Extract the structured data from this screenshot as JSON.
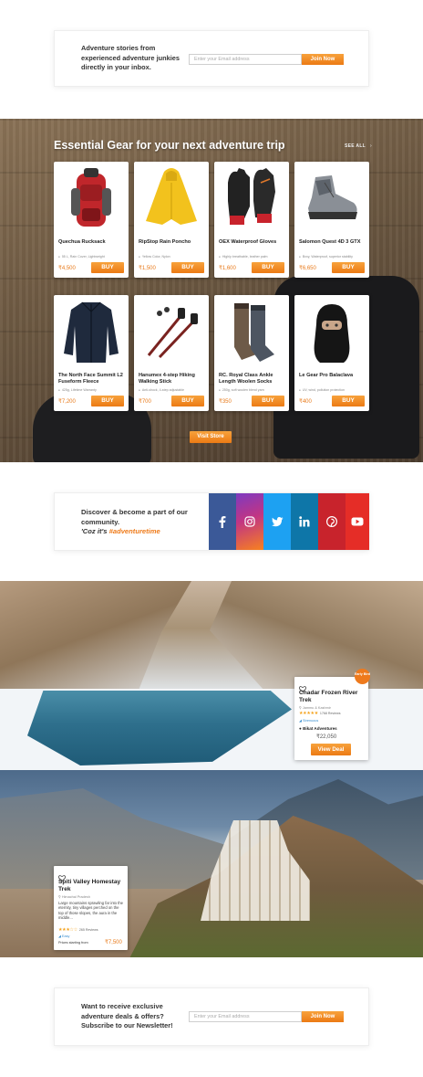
{
  "newsletter_top": {
    "text": "Adventure stories from experienced adventure junkies directly in your inbox.",
    "placeholder": "Enter your Email address",
    "button": "Join Now"
  },
  "gear": {
    "title": "Essential Gear for your next adventure trip",
    "see_all": "SEE ALL",
    "buy_label": "BUY",
    "visit_store": "Visit Store",
    "products": [
      {
        "name": "Quechua Rucksack",
        "feature": "55 L, Rain Cover, Lightweight",
        "price": "₹4,500",
        "icon": "rucksack-icon"
      },
      {
        "name": "RipStop Rain Poncho",
        "feature": "Yellow Color, Nylon",
        "price": "₹1,500",
        "icon": "poncho-icon"
      },
      {
        "name": "OEX Waterproof Gloves",
        "feature": "Highly breathable, leather palm",
        "price": "₹1,600",
        "icon": "gloves-icon"
      },
      {
        "name": "Salomon Quest 4D 3 GTX",
        "feature": "Bxxy, Waterproof, superior stability",
        "price": "₹6,650",
        "icon": "boot-icon"
      },
      {
        "name": "The North Face Summit L2 Fuseform Fleece",
        "feature": "425g, Lifetime Warranty",
        "price": "₹7,200",
        "icon": "fleece-icon"
      },
      {
        "name": "Hanumex 4-step Hiking Walking Stick",
        "feature": "Anti-shock, 4-step adjustable",
        "price": "₹700",
        "icon": "walking-stick-icon"
      },
      {
        "name": "RC. Royal Class Ankle Length Woolen Socks",
        "feature": "250g, soft woolen blend yarn",
        "price": "₹350",
        "icon": "socks-icon"
      },
      {
        "name": "Le Gear Pro Balaclava",
        "feature": "UV, wind, pollution protection",
        "price": "₹400",
        "icon": "balaclava-icon"
      }
    ]
  },
  "community": {
    "line1": "Discover & become a part of our community.",
    "tag_prefix": "'Coz it's ",
    "hashtag": "#adventuretime",
    "socials": [
      {
        "name": "facebook",
        "color": "#3b5998"
      },
      {
        "name": "instagram",
        "color": "#c13584"
      },
      {
        "name": "twitter",
        "color": "#1da1f2"
      },
      {
        "name": "linkedin",
        "color": "#0e76a8"
      },
      {
        "name": "pinterest",
        "color": "#c8232c"
      },
      {
        "name": "youtube",
        "color": "#e52d27"
      }
    ]
  },
  "trek_chadar": {
    "badge": "Early Bird",
    "name": "Chadar Frozen River Trek",
    "location": "Jammu & Kashmir",
    "stars": "★★★★★",
    "reviews": "1768 Reviews",
    "difficulty": "Strenuous",
    "operator": "Bikat Adventures",
    "price": "₹22,050",
    "button": "View Deal"
  },
  "trek_spiti": {
    "name": "Spiti Valley Homestay Trek",
    "location": "Himachal Pradesh",
    "description": "Large mountains sprawling far into the eternity, tiny villages perched on the top of those slopes, the aura in the middle...",
    "stars": "★★★☆☆",
    "reviews": "265 Reviews",
    "difficulty": "Easy",
    "price_label": "Prices starting from",
    "price": "₹7,500"
  },
  "newsletter_bottom": {
    "text": "Want to receive exclusive adventure deals & offers? Subscribe to our Newsletter!",
    "placeholder": "Enter your Email address",
    "button": "Join Now"
  }
}
